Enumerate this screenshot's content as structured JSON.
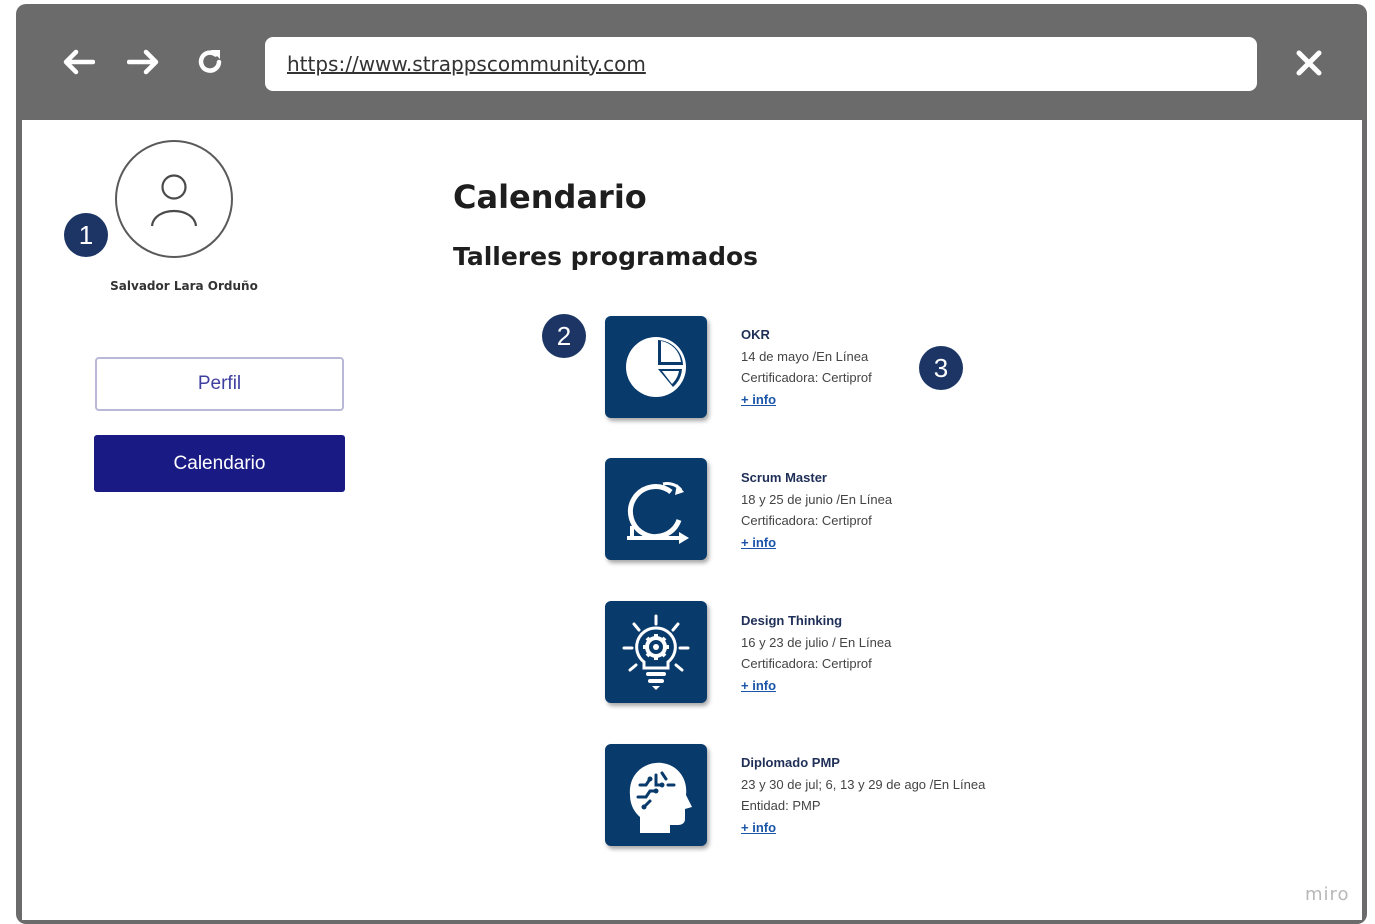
{
  "browser": {
    "url": "https://www.strappscommunity.com"
  },
  "annotations": [
    "1",
    "2",
    "3"
  ],
  "sidebar": {
    "user_name": "Salvador Lara Orduño",
    "buttons": {
      "perfil": "Perfil",
      "calendario": "Calendario"
    }
  },
  "main": {
    "title": "Calendario",
    "section": "Talleres programados",
    "workshops": [
      {
        "icon": "pie-chart-icon",
        "title": "OKR",
        "date": "14 de mayo /En Línea",
        "org": "Certificadora: Certiprof",
        "link": "+ info"
      },
      {
        "icon": "scrum-cycle-icon",
        "title": "Scrum Master",
        "date": "18 y 25 de junio /En Línea",
        "org": "Certificadora: Certiprof",
        "link": "+ info"
      },
      {
        "icon": "lightbulb-gear-icon",
        "title": "Design Thinking",
        "date": "16 y 23 de julio / En Línea",
        "org": "Certificadora: Certiprof",
        "link": "+ info"
      },
      {
        "icon": "brain-head-icon",
        "title": "Diplomado PMP",
        "date": "23 y 30 de jul; 6, 13 y 29 de ago /En Línea",
        "org": "Entidad: PMP",
        "link": "+ info"
      }
    ]
  },
  "watermark": "miro",
  "colors": {
    "chrome": "#6b6b6b",
    "primary": "#1a1a85",
    "tile": "#083a6b",
    "badge": "#1c3565"
  }
}
